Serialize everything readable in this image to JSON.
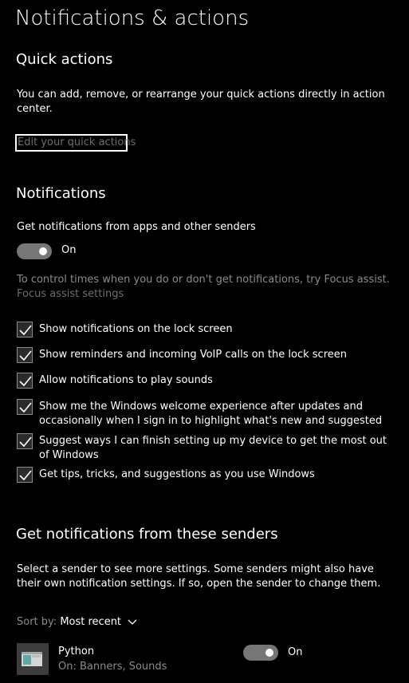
{
  "page_title": "Notifications & actions",
  "quick_actions": {
    "heading": "Quick actions",
    "description": "You can add, remove, or rearrange your quick actions directly in action center.",
    "edit_link": "Edit your quick actions"
  },
  "notifications": {
    "heading": "Notifications",
    "get_label": "Get notifications from apps and other senders",
    "toggle_state": "On",
    "focus_text": "To control times when you do or don't get notifications, try Focus assist.",
    "focus_link": "Focus assist settings",
    "checkboxes": [
      {
        "label": "Show notifications on the lock screen",
        "checked": true
      },
      {
        "label": "Show reminders and incoming VoIP calls on the lock screen",
        "checked": true
      },
      {
        "label": "Allow notifications to play sounds",
        "checked": true
      },
      {
        "label": "Show me the Windows welcome experience after updates and occasionally when I sign in to highlight what's new and suggested",
        "checked": true
      },
      {
        "label": "Suggest ways I can finish setting up my device to get the most out of Windows",
        "checked": true
      },
      {
        "label": "Get tips, tricks, and suggestions as you use Windows",
        "checked": true
      }
    ]
  },
  "senders": {
    "heading": "Get notifications from these senders",
    "description": "Select a sender to see more settings. Some senders might also have their own notification settings. If so, open the sender to change them.",
    "sort_label": "Sort by:",
    "sort_value": "Most recent",
    "apps": [
      {
        "name": "Python",
        "subtitle": "On: Banners, Sounds",
        "toggle_state": "On",
        "icon": "python-app-icon"
      }
    ]
  },
  "colors": {
    "background": "#000000",
    "toggle_on": "#767676",
    "muted_text": "#8a8a8a"
  }
}
